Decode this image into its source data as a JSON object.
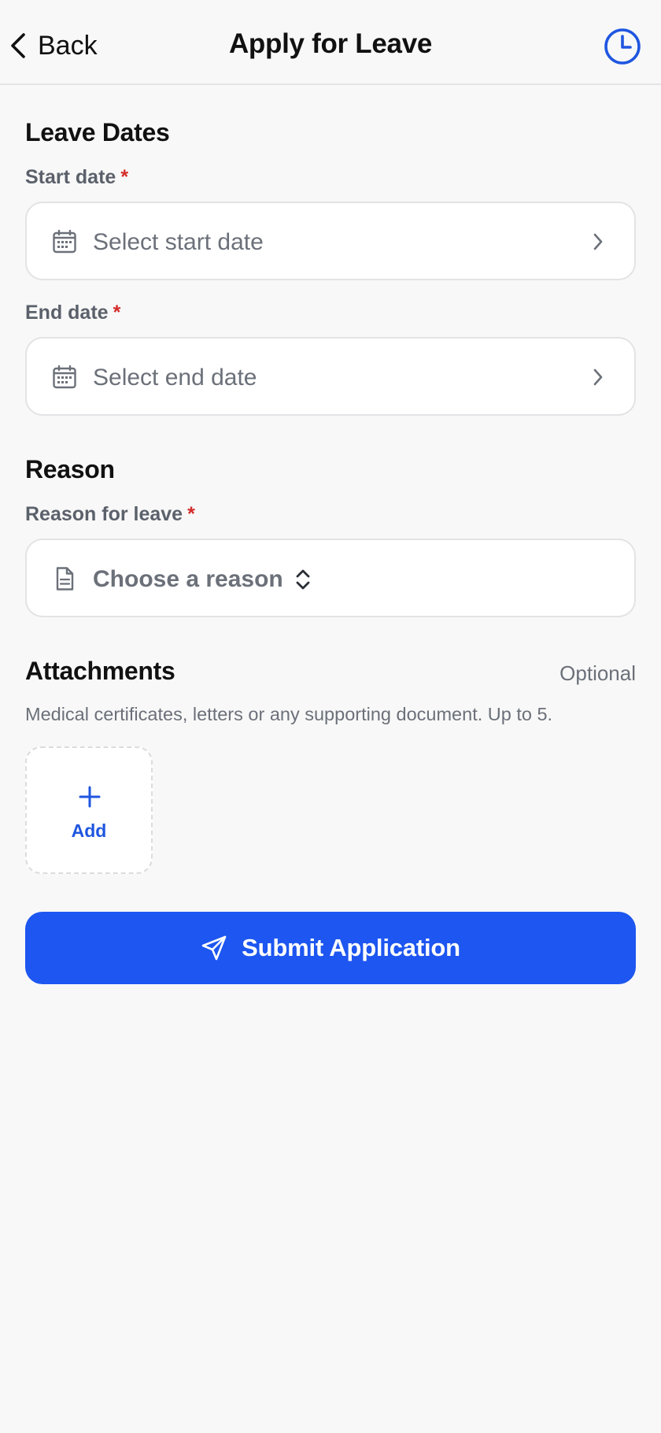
{
  "header": {
    "back_label": "Back",
    "title": "Apply for Leave"
  },
  "leave_dates": {
    "section_title": "Leave Dates",
    "start_date": {
      "label": "Start date",
      "required_mark": "*",
      "placeholder": "Select start date"
    },
    "end_date": {
      "label": "End date",
      "required_mark": "*",
      "placeholder": "Select end date"
    }
  },
  "reason": {
    "section_title": "Reason",
    "label": "Reason for leave",
    "required_mark": "*",
    "placeholder": "Choose a reason"
  },
  "attachments": {
    "section_title": "Attachments",
    "optional_label": "Optional",
    "help_text": "Medical certificates, letters or any supporting document. Up to 5.",
    "add_label": "Add"
  },
  "submit": {
    "label": "Submit Application"
  },
  "colors": {
    "accent": "#1d56f0",
    "required": "#d42a2a",
    "muted_text": "#6b7079",
    "background": "#f8f8f8"
  },
  "icons": {
    "back": "chevron-left-icon",
    "history": "clock-icon",
    "date_field": "calendar-icon",
    "date_field_action": "chevron-right-icon",
    "reason_field": "document-icon",
    "reason_field_action": "chevron-up-down-icon",
    "add_attachment": "plus-icon",
    "submit": "send-icon"
  }
}
